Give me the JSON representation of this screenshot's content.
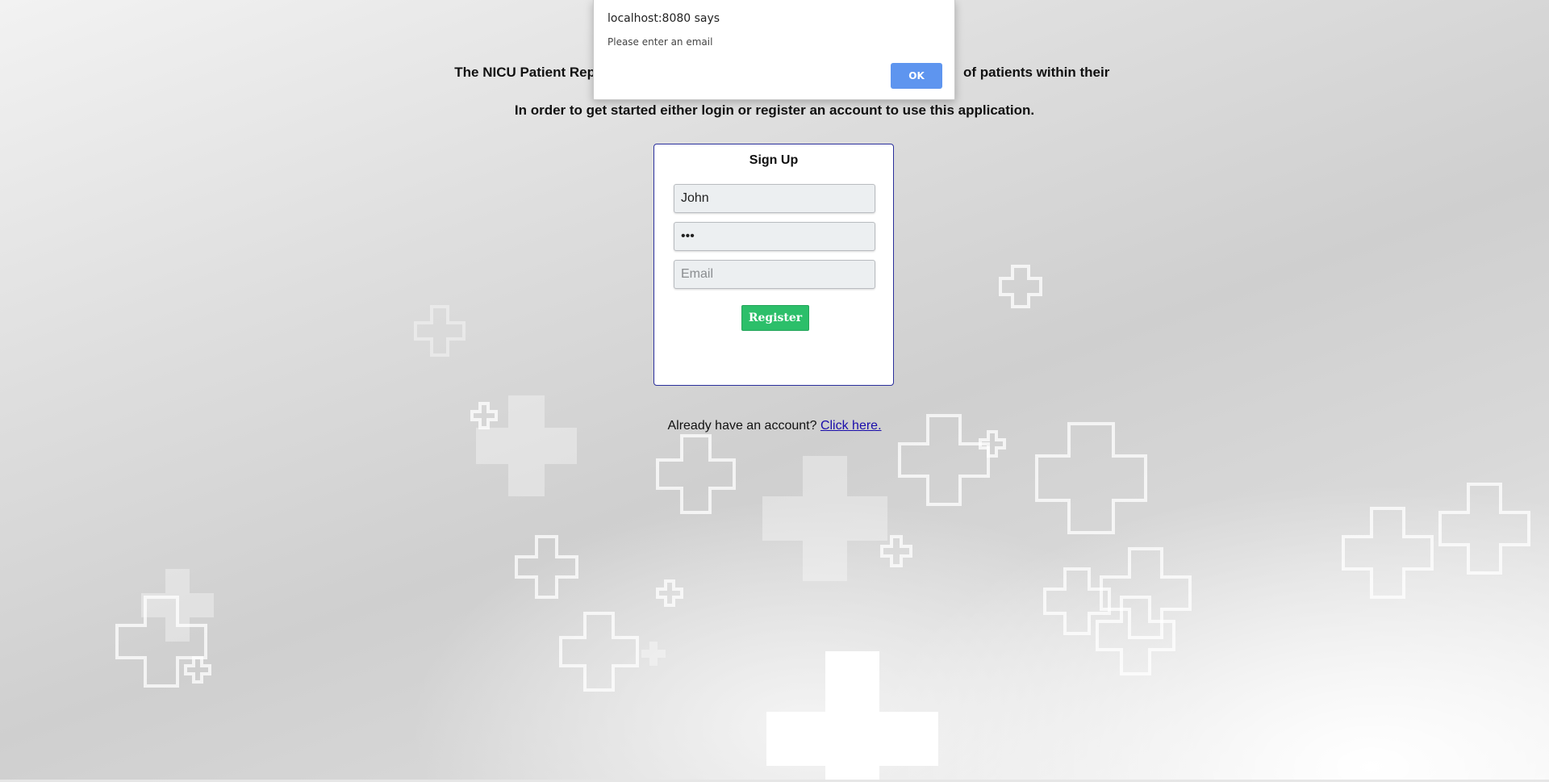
{
  "intro": {
    "line1_left": "The NICU Patient Rep",
    "line1_right": "of patients within their",
    "line2": "In order to get started either login or register an account to use this application."
  },
  "signup": {
    "title": "Sign Up",
    "username_value": "John",
    "password_value": "abc",
    "email_placeholder": "Email",
    "register_label": "Register"
  },
  "login": {
    "prompt": "Already have an account?",
    "link_label": "Click here."
  },
  "dialog": {
    "origin": "localhost:8080 says",
    "message": "Please enter an email",
    "ok_label": "OK"
  },
  "colors": {
    "card_border": "#2a2f9c",
    "register_button": "#2cbf6a",
    "ok_button": "#5e95ef",
    "link": "#1a0dab"
  }
}
